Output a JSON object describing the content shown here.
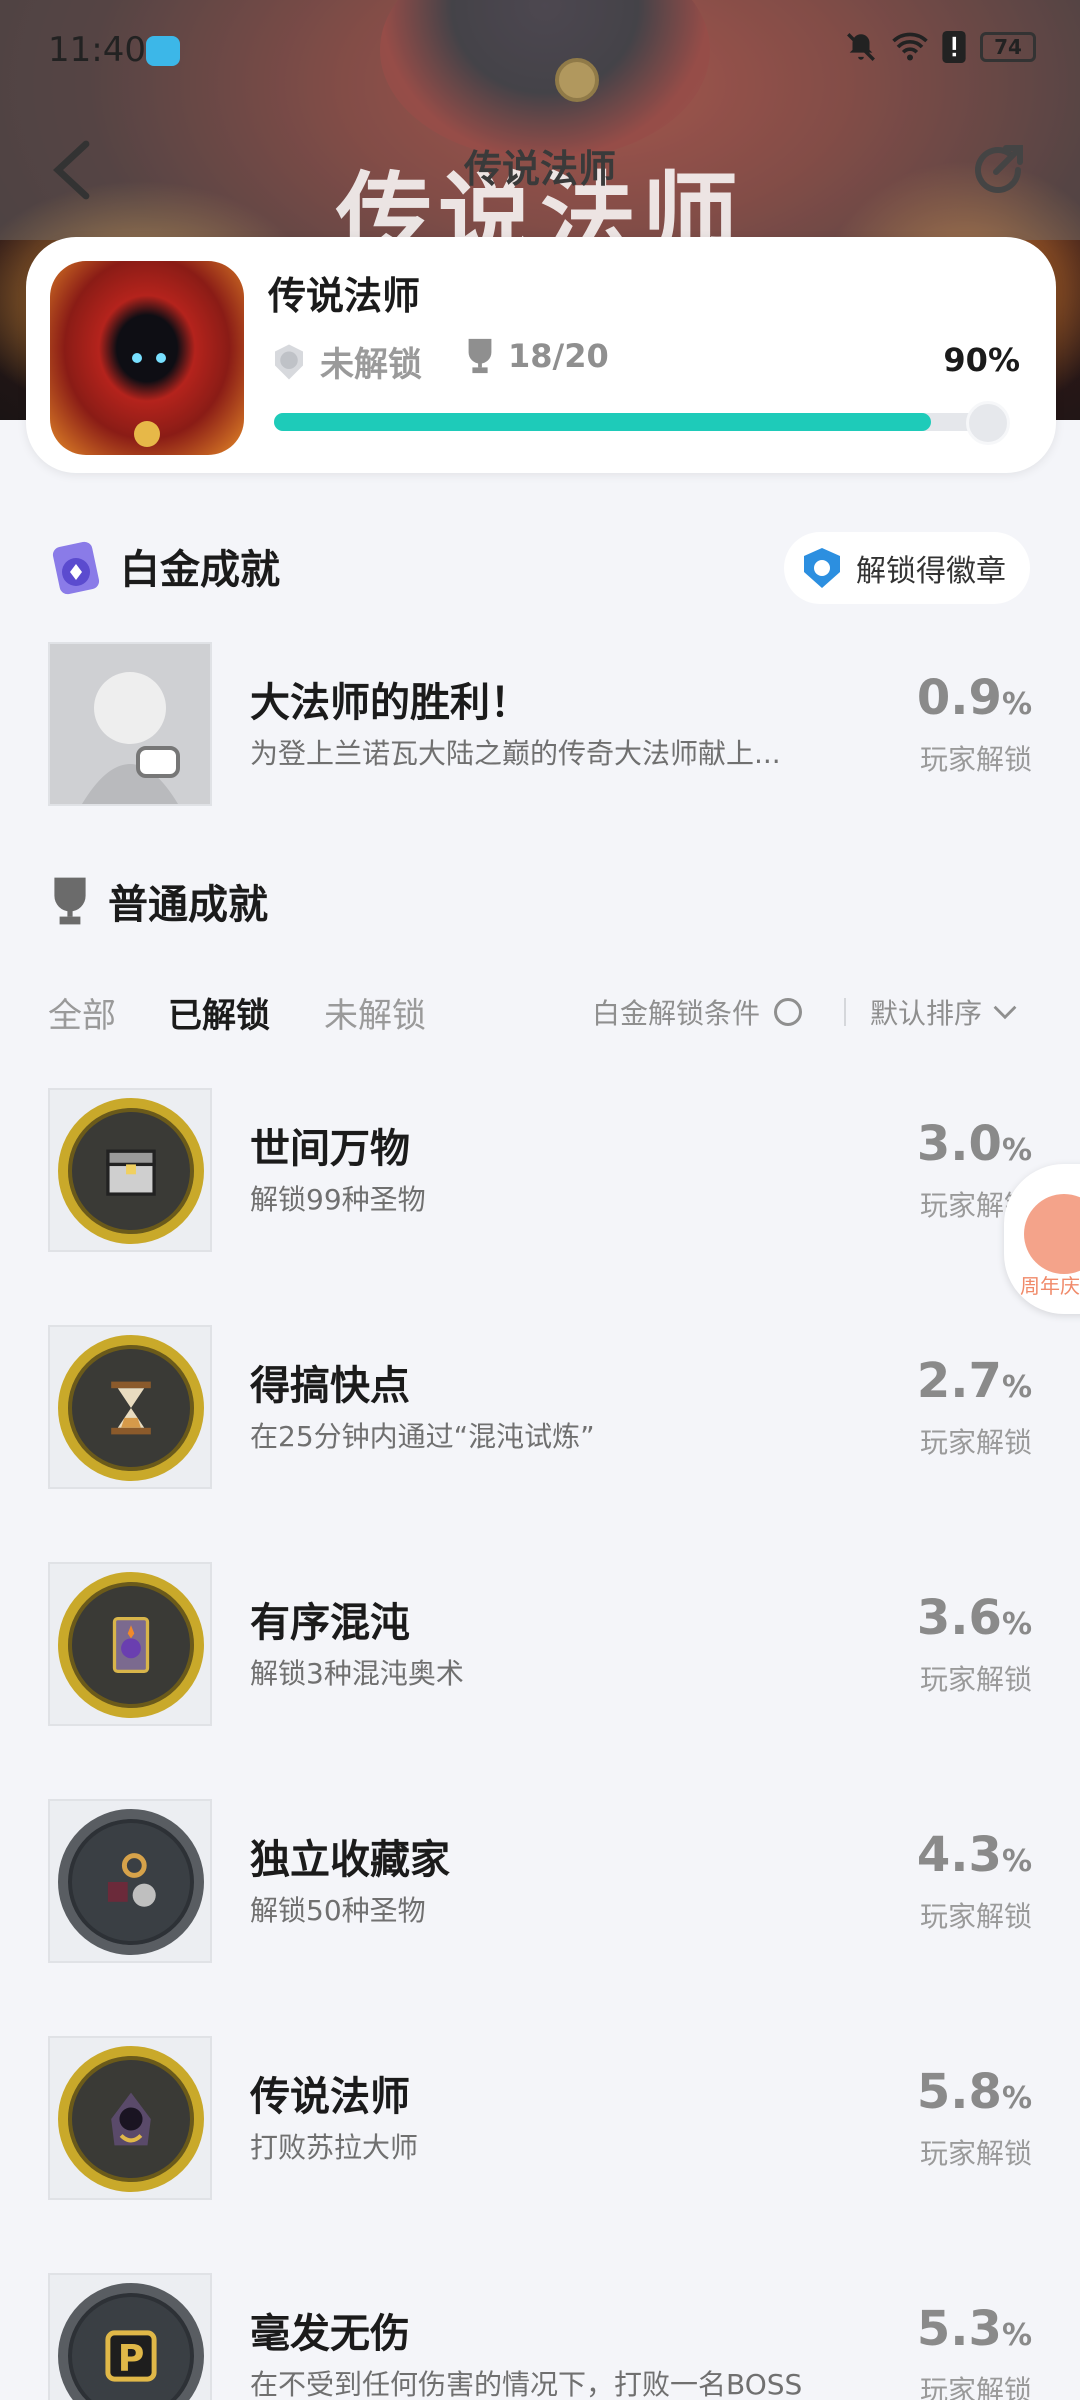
{
  "status_bar": {
    "time": "11:40",
    "battery": "74"
  },
  "nav": {
    "title": "传说法师"
  },
  "banner": {
    "art_title": "传说法师"
  },
  "game": {
    "name": "传说法师",
    "platinum_status": "未解锁",
    "trophy_count": "18/20",
    "progress_percent": "90%",
    "progress_value": 0.9
  },
  "platinum_section": {
    "title": "白金成就",
    "badge_button": "解锁得徽章",
    "item": {
      "name": "大法师的胜利！",
      "desc": "为登上兰诺瓦大陆之巅的传奇大法师献上...",
      "pct": "0.9",
      "pct_unit": "%",
      "pct_label": "玩家解锁"
    }
  },
  "normal_section": {
    "title": "普通成就",
    "tabs": [
      "全部",
      "已解锁",
      "未解锁"
    ],
    "active_tab": 1,
    "condition_label": "白金解锁条件",
    "sort_label": "默认排序"
  },
  "achievements": [
    {
      "name": "世间万物",
      "desc": "解锁99种圣物",
      "pct": "3.0",
      "pct_unit": "%",
      "pct_label": "玩家解锁",
      "icon": "chest-icon",
      "ring": "gold"
    },
    {
      "name": "得搞快点",
      "desc": "在25分钟内通过“混沌试炼”",
      "pct": "2.7",
      "pct_unit": "%",
      "pct_label": "玩家解锁",
      "icon": "hourglass-icon",
      "ring": "gold"
    },
    {
      "name": "有序混沌",
      "desc": "解锁3种混沌奥术",
      "pct": "3.6",
      "pct_unit": "%",
      "pct_label": "玩家解锁",
      "icon": "arcana-card-icon",
      "ring": "gold"
    },
    {
      "name": "独立收藏家",
      "desc": "解锁50种圣物",
      "pct": "4.3",
      "pct_unit": "%",
      "pct_label": "玩家解锁",
      "icon": "relics-icon",
      "ring": "grey"
    },
    {
      "name": "传说法师",
      "desc": "打败苏拉大师",
      "pct": "5.8",
      "pct_unit": "%",
      "pct_label": "玩家解锁",
      "icon": "hooded-wizard-icon",
      "ring": "gold"
    },
    {
      "name": "毫发无伤",
      "desc": "在不受到任何伤害的情况下，打败一名BOSS",
      "pct": "5.3",
      "pct_unit": "%",
      "pct_label": "玩家解锁",
      "icon": "p-badge-icon",
      "ring": "grey"
    }
  ],
  "side_chip": {
    "text": "周年庆"
  },
  "colors": {
    "accent": "#1ecbb9",
    "gold_ring": "#c9a92a",
    "grey_ring": "#595d62",
    "bg": "#f4f5f9"
  }
}
